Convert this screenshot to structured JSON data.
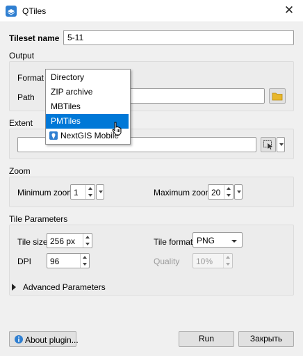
{
  "window": {
    "title": "QTiles",
    "close_glyph": "✕"
  },
  "tileset": {
    "label": "Tileset name",
    "value": "5-11"
  },
  "output": {
    "section_label": "Output",
    "format_label": "Format",
    "path_label": "Path",
    "format_options": [
      "Directory",
      "ZIP archive",
      "MBTiles",
      "PMTiles",
      "NextGIS Mobile"
    ],
    "selected_option": "PMTiles"
  },
  "extent": {
    "section_label": "Extent"
  },
  "zoom": {
    "section_label": "Zoom",
    "min_label": "Minimum zoom",
    "min_value": "1",
    "max_label": "Maximum zoom",
    "max_value": "20"
  },
  "tile_params": {
    "section_label": "Tile Parameters",
    "tile_size_label": "Tile size",
    "tile_size_value": "256 px",
    "tile_format_label": "Tile format",
    "tile_format_value": "PNG",
    "dpi_label": "DPI",
    "dpi_value": "96",
    "quality_label": "Quality",
    "quality_value": "10%"
  },
  "advanced": {
    "label": "Advanced Parameters"
  },
  "buttons": {
    "about": "About plugin...",
    "run": "Run",
    "close": "Закрыть"
  },
  "colors": {
    "selection": "#0078d7",
    "folder": "#e8b72c",
    "brand": "#2f7fd1"
  }
}
